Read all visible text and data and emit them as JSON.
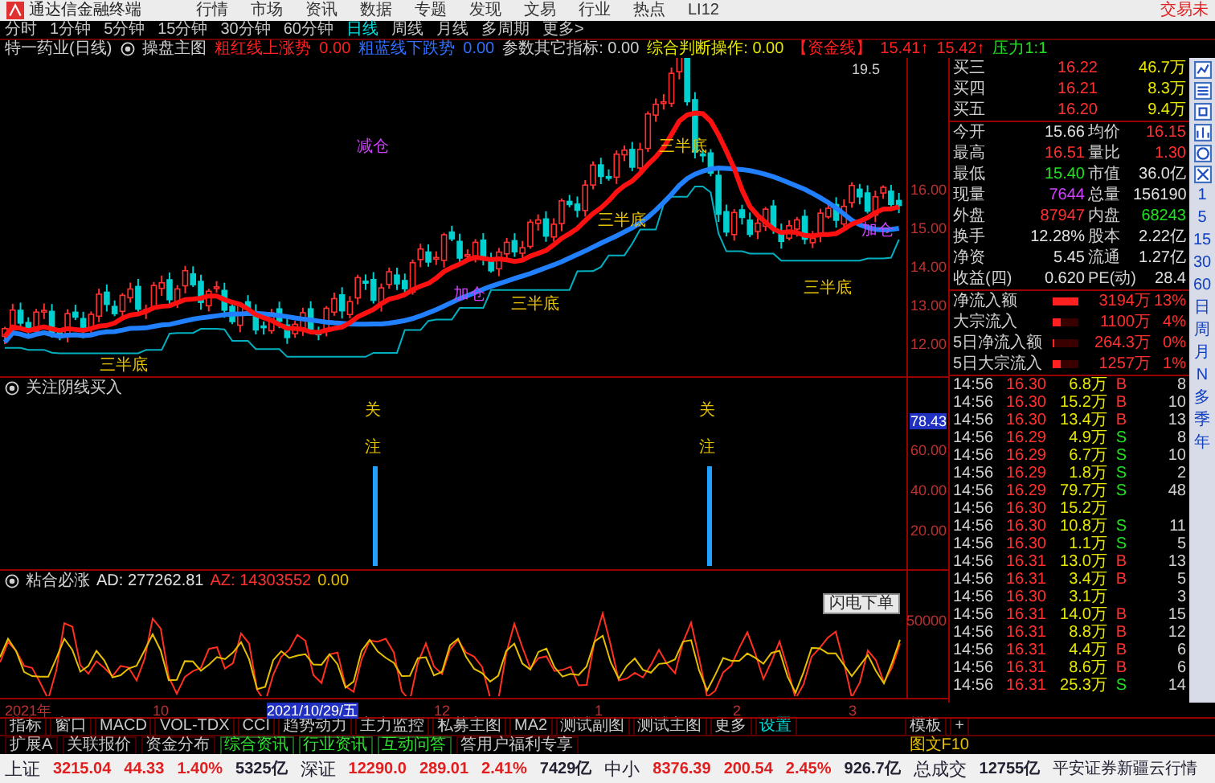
{
  "menu": {
    "title": "通达信金融终端",
    "items": [
      {
        "label": "行情"
      },
      {
        "label": "市场"
      },
      {
        "label": "资讯"
      },
      {
        "label": "数据"
      },
      {
        "label": "专题"
      },
      {
        "label": "发现"
      },
      {
        "label": "文易"
      },
      {
        "label": "行业"
      },
      {
        "label": "热点"
      },
      {
        "label": "LI12"
      }
    ],
    "trade": "交易未"
  },
  "periods": [
    {
      "label": "分时",
      "selected": false
    },
    {
      "label": "1分钟",
      "selected": false
    },
    {
      "label": "5分钟",
      "selected": false
    },
    {
      "label": "15分钟",
      "selected": false
    },
    {
      "label": "30分钟",
      "selected": false
    },
    {
      "label": "60分钟",
      "selected": false
    },
    {
      "label": "日线",
      "selected": true
    },
    {
      "label": "周线",
      "selected": false
    },
    {
      "label": "月线",
      "selected": false
    },
    {
      "label": "多周期",
      "selected": false
    },
    {
      "label": "更多>",
      "selected": false
    }
  ],
  "info": {
    "stock": "特一药业(日线)",
    "main": "操盘主图",
    "segments": [
      {
        "text": "粗红线上涨势",
        "color": "#ff2020"
      },
      {
        "text": "0.00",
        "color": "#ff2020"
      },
      {
        "text": "粗蓝线下跌势",
        "color": "#3070ff"
      },
      {
        "text": "0.00",
        "color": "#3070ff"
      },
      {
        "text": "参数其它指标: 0.00",
        "color": "#d0d0d0"
      },
      {
        "text": "综合判断操作: 0.00",
        "color": "#e6e600"
      },
      {
        "text": "【资金线】",
        "color": "#ff2020"
      },
      {
        "text": "15.41↑",
        "color": "#ff2020"
      },
      {
        "text": "15.42↑",
        "color": "#ff2020"
      },
      {
        "text": "压力1:1",
        "color": "#20e020"
      }
    ]
  },
  "main_chart": {
    "price_axis": [
      "16.00",
      "15.00",
      "14.00",
      "13.00",
      "12.00"
    ],
    "peak": "19.5",
    "annotations": [
      "三半底",
      "三半底",
      "三半底",
      "三半底",
      "三半底",
      "减仓",
      "加仓",
      "加仓"
    ]
  },
  "indicator_1": {
    "title": "关注阴线买入",
    "axis": [
      {
        "label": "78.43",
        "selected": true
      },
      {
        "label": "60.00",
        "selected": false
      },
      {
        "label": "40.00",
        "selected": false
      },
      {
        "label": "20.00",
        "selected": false
      }
    ],
    "signals": [
      {
        "top": "关",
        "bottom": "注"
      },
      {
        "top": "关",
        "bottom": "注"
      }
    ]
  },
  "indicator_2": {
    "name": "粘合必涨",
    "values": [
      {
        "label": "AD:",
        "value": "277262.81"
      },
      {
        "label": "AZ:",
        "value": "14303552"
      },
      {
        "value": "0.00"
      }
    ],
    "axis": [
      "50000"
    ]
  },
  "date_axis": [
    {
      "label": "2021年",
      "selected": false
    },
    {
      "label": "10",
      "selected": false
    },
    {
      "label": "2021/10/29/五",
      "selected": true
    },
    {
      "label": "12",
      "selected": false
    },
    {
      "label": "1",
      "selected": false
    },
    {
      "label": "2",
      "selected": false
    },
    {
      "label": "3",
      "selected": false
    }
  ],
  "indicator_tabs": [
    {
      "label": "指标",
      "selected": false
    },
    {
      "label": "窗口",
      "selected": false
    },
    {
      "label": "MACD",
      "selected": false
    },
    {
      "label": "VOL-TDX",
      "selected": false
    },
    {
      "label": "CCI",
      "selected": false
    },
    {
      "label": "趋势动力",
      "selected": false
    },
    {
      "label": "主力监控",
      "selected": false
    },
    {
      "label": "私募主图",
      "selected": false
    },
    {
      "label": "MA2",
      "selected": false
    },
    {
      "label": "测试副图",
      "selected": false
    },
    {
      "label": "测试主图",
      "selected": false
    },
    {
      "label": "更多",
      "selected": false
    },
    {
      "label": "设置",
      "selected": true
    }
  ],
  "template": {
    "label": "模板",
    "add": "+"
  },
  "extensions": [
    {
      "label": "扩展A",
      "highlighted": false
    },
    {
      "label": "关联报价",
      "highlighted": false
    },
    {
      "label": "资金分布",
      "highlighted": false
    },
    {
      "label": "综合资讯",
      "highlighted": true
    },
    {
      "label": "行业资讯",
      "highlighted": true
    },
    {
      "label": "互动问答",
      "highlighted": true
    },
    {
      "label": "答用户福利专享",
      "highlighted": false
    }
  ],
  "f10": "图文F10",
  "quote": {
    "orders": [
      {
        "label": "买三",
        "price": "16.22",
        "volume": "46.7万"
      },
      {
        "label": "买四",
        "price": "16.21",
        "volume": "8.3万"
      },
      {
        "label": "买五",
        "price": "16.20",
        "volume": "9.4万"
      }
    ],
    "stats": [
      {
        "cells": [
          {
            "label": "今开",
            "value": "15.66",
            "color": "#e0e0e0"
          },
          {
            "label": "均价",
            "value": "16.15",
            "color": "#ff3030"
          }
        ]
      },
      {
        "cells": [
          {
            "label": "最高",
            "value": "16.51",
            "color": "#ff3030"
          },
          {
            "label": "量比",
            "value": "1.30",
            "color": "#ff3030"
          }
        ]
      },
      {
        "cells": [
          {
            "label": "最低",
            "value": "15.40",
            "color": "#20e020"
          },
          {
            "label": "市值",
            "value": "36.0亿",
            "color": "#e0e0e0"
          }
        ]
      },
      {
        "cells": [
          {
            "label": "现量",
            "value": "7644",
            "color": "#d040ff"
          },
          {
            "label": "总量",
            "value": "156190",
            "color": "#e0e0e0"
          }
        ]
      },
      {
        "cells": [
          {
            "label": "外盘",
            "value": "87947",
            "color": "#ff3030"
          },
          {
            "label": "内盘",
            "value": "68243",
            "color": "#20e020"
          }
        ]
      },
      {
        "cells": [
          {
            "label": "换手",
            "value": "12.28%",
            "color": "#e0e0e0"
          },
          {
            "label": "股本",
            "value": "2.22亿",
            "color": "#e0e0e0"
          }
        ]
      },
      {
        "cells": [
          {
            "label": "净资",
            "value": "5.45",
            "color": "#e0e0e0"
          },
          {
            "label": "流通",
            "value": "1.27亿",
            "color": "#e0e0e0"
          }
        ]
      },
      {
        "cells": [
          {
            "label": "收益(四)",
            "value": "0.620",
            "color": "#e0e0e0"
          },
          {
            "label": "PE(动)",
            "value": "28.4",
            "color": "#e0e0e0"
          }
        ]
      }
    ],
    "flows": [
      {
        "label": "净流入额",
        "level": 1,
        "amount": "3194万",
        "share": "13%"
      },
      {
        "label": "大宗流入",
        "level": 0.3,
        "amount": "1100万",
        "share": "4%"
      },
      {
        "label": "5日净流入额",
        "level": 0.05,
        "amount": "264.3万",
        "share": "0%"
      },
      {
        "label": "5日大宗流入",
        "level": 0.3,
        "amount": "1257万",
        "share": "1%"
      }
    ]
  },
  "ticks": [
    {
      "time": "14:56",
      "price": "16.30",
      "volume": "6.8万",
      "side": "B",
      "count": "8"
    },
    {
      "time": "14:56",
      "price": "16.30",
      "volume": "15.2万",
      "side": "B",
      "count": "10"
    },
    {
      "time": "14:56",
      "price": "16.30",
      "volume": "13.4万",
      "side": "B",
      "count": "13"
    },
    {
      "time": "14:56",
      "price": "16.29",
      "volume": "4.9万",
      "side": "S",
      "count": "8"
    },
    {
      "time": "14:56",
      "price": "16.29",
      "volume": "6.7万",
      "side": "S",
      "count": "10"
    },
    {
      "time": "14:56",
      "price": "16.29",
      "volume": "1.8万",
      "side": "S",
      "count": "2"
    },
    {
      "time": "14:56",
      "price": "16.29",
      "volume": "79.7万",
      "side": "S",
      "count": "48"
    },
    {
      "time": "14:56",
      "price": "16.30",
      "volume": "15.2万"
    },
    {
      "time": "14:56",
      "price": "16.30",
      "volume": "10.8万",
      "side": "S",
      "count": "11"
    },
    {
      "time": "14:56",
      "price": "16.30",
      "volume": "1.1万",
      "side": "S",
      "count": "5"
    },
    {
      "time": "14:56",
      "price": "16.31",
      "volume": "13.0万",
      "side": "B",
      "count": "13"
    },
    {
      "time": "14:56",
      "price": "16.31",
      "volume": "3.4万",
      "side": "B",
      "count": "5"
    },
    {
      "time": "14:56",
      "price": "16.30",
      "volume": "3.1万",
      "count": "3"
    },
    {
      "time": "14:56",
      "price": "16.31",
      "volume": "14.0万",
      "side": "B",
      "count": "15"
    },
    {
      "time": "14:56",
      "price": "16.31",
      "volume": "8.8万",
      "side": "B",
      "count": "12"
    },
    {
      "time": "14:56",
      "price": "16.31",
      "volume": "4.4万",
      "side": "B",
      "count": "6"
    },
    {
      "time": "14:56",
      "price": "16.31",
      "volume": "8.6万",
      "side": "B",
      "count": "6"
    },
    {
      "time": "14:56",
      "price": "16.31",
      "volume": "25.3万",
      "side": "S",
      "count": "14"
    }
  ],
  "popup": "闪电下单",
  "side_periods": [
    "1",
    "5",
    "15",
    "30",
    "60",
    "日",
    "周",
    "月",
    "N",
    "多",
    "季",
    "年"
  ],
  "status": {
    "indices": [
      {
        "name": "上证",
        "value": "3215.04",
        "change": "44.33",
        "pct": "1.40%",
        "turnover": "5325亿"
      },
      {
        "name": "深证",
        "value": "12290.0",
        "change": "289.01",
        "pct": "2.41%",
        "turnover": "7429亿"
      },
      {
        "name": "中小",
        "value": "8376.39",
        "change": "200.54",
        "pct": "2.45%",
        "turnover": "926.7亿"
      }
    ],
    "total_label": "总成交",
    "total": "12755亿",
    "source": "平安证券新疆云行情"
  }
}
